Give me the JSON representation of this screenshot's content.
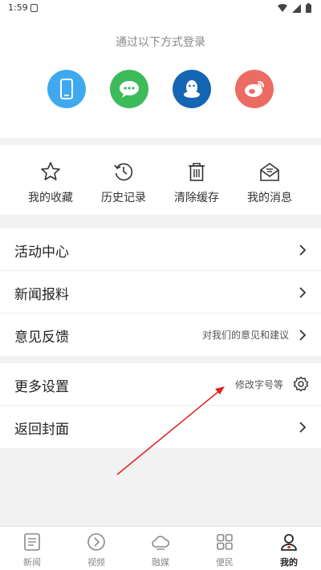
{
  "status_bar": {
    "time": "1:59"
  },
  "login": {
    "hint": "通过以下方式登录",
    "methods": [
      {
        "icon": "phone-icon",
        "color": "#3fa9f0"
      },
      {
        "icon": "wechat-icon",
        "color": "#3dbb5a"
      },
      {
        "icon": "qq-icon",
        "color": "#1565b5"
      },
      {
        "icon": "weibo-icon",
        "color": "#ec6c64"
      }
    ]
  },
  "quick_actions": [
    {
      "label": "我的收藏",
      "icon": "star-icon"
    },
    {
      "label": "历史记录",
      "icon": "history-icon"
    },
    {
      "label": "清除缓存",
      "icon": "trash-icon"
    },
    {
      "label": "我的消息",
      "icon": "mail-icon"
    }
  ],
  "menu": {
    "activity": "活动中心",
    "news_tip": "新闻报料",
    "feedback": "意见反馈",
    "feedback_sub": "对我们的意见和建议",
    "more_settings": "更多设置",
    "more_settings_sub": "修改字号等",
    "back_cover": "返回封面"
  },
  "tabs": [
    {
      "label": "新闻",
      "icon": "news-icon",
      "active": false
    },
    {
      "label": "视频",
      "icon": "video-icon",
      "active": false
    },
    {
      "label": "融媒",
      "icon": "cloud-icon",
      "active": false
    },
    {
      "label": "便民",
      "icon": "grid-icon",
      "active": false
    },
    {
      "label": "我的",
      "icon": "profile-icon",
      "active": true
    }
  ],
  "colors": {
    "accent": "#e22b2b",
    "annotation_arrow": "#e02020"
  }
}
